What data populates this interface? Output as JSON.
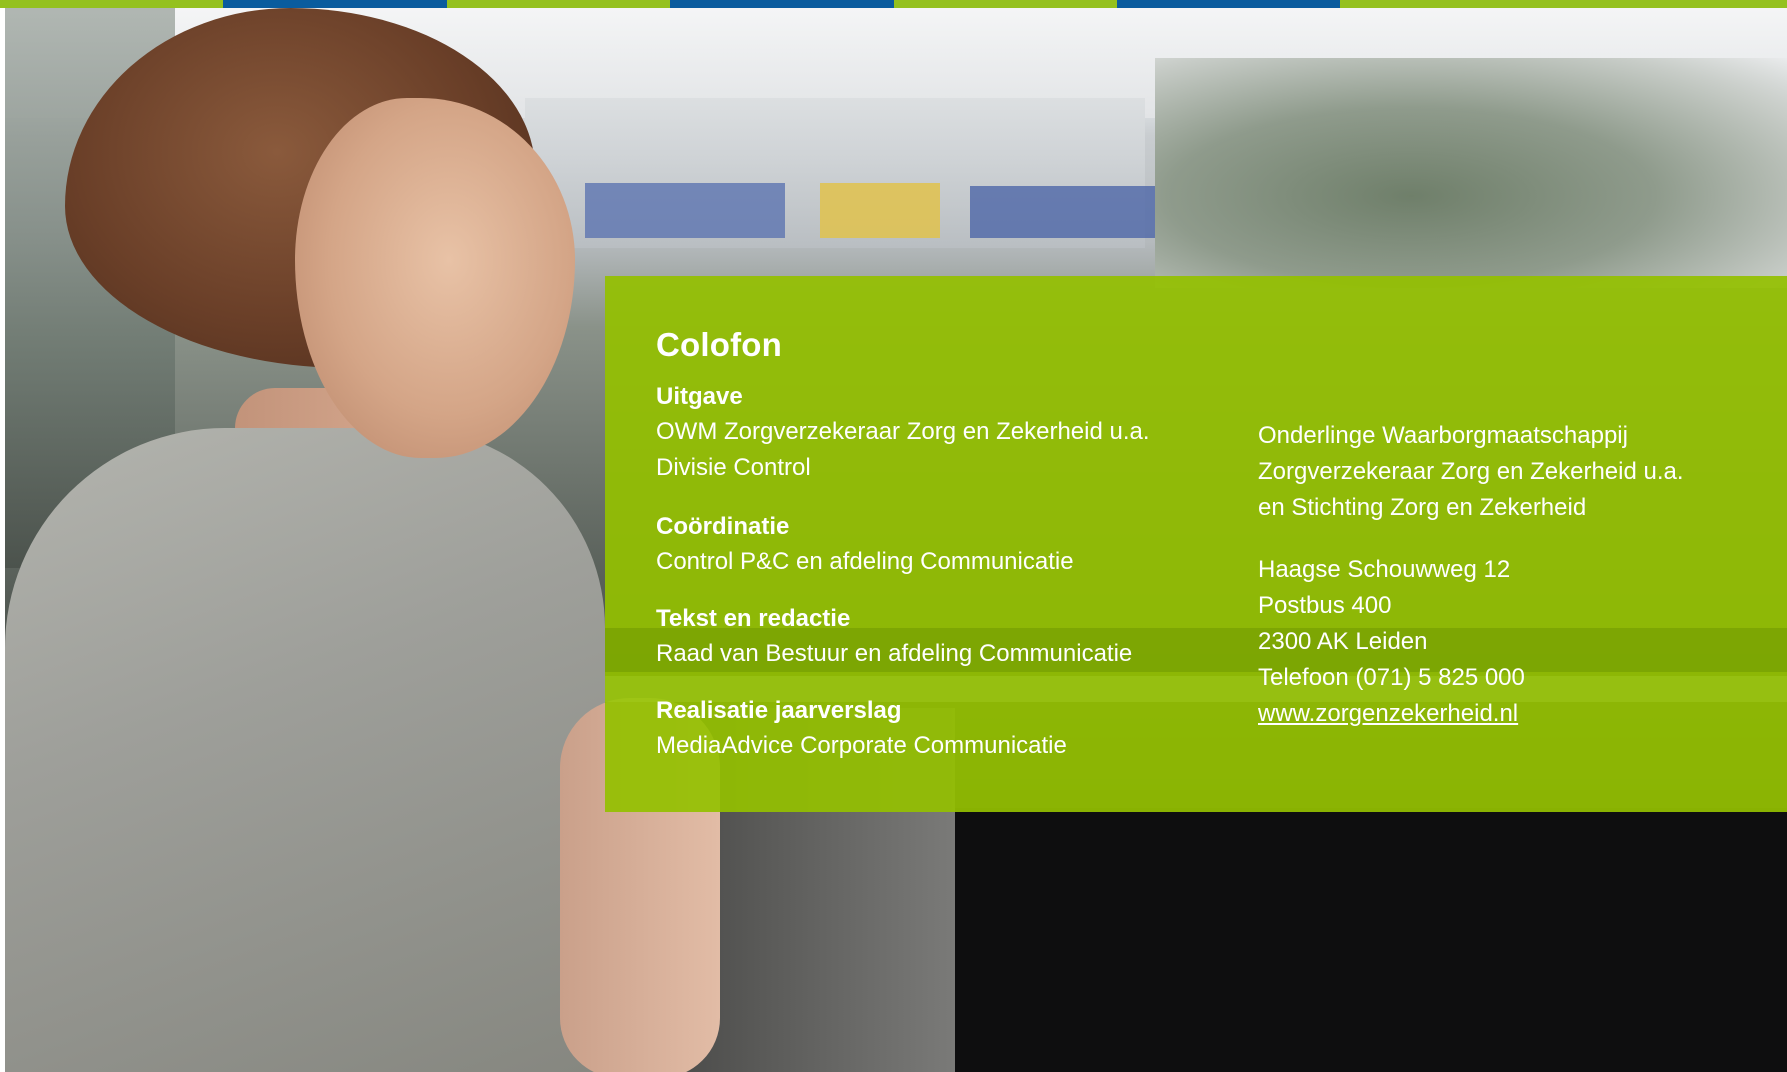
{
  "stripe_colors": [
    "#94c11f",
    "#0a5c9e",
    "#94c11f",
    "#0a5c9e",
    "#94c11f",
    "#0a5c9e",
    "#94c11f",
    "#94c11f"
  ],
  "colofon": {
    "title": "Colofon",
    "sections": [
      {
        "heading": "Uitgave",
        "lines": [
          "OWM Zorgverzekeraar Zorg en Zekerheid u.a.",
          "Divisie Control"
        ]
      },
      {
        "heading": "Coördinatie",
        "lines": [
          "Control P&C en afdeling Communicatie"
        ]
      },
      {
        "heading": "Tekst en redactie",
        "lines": [
          "Raad van Bestuur en afdeling Communicatie"
        ]
      },
      {
        "heading": "Realisatie jaarverslag",
        "lines": [
          "MediaAdvice Corporate Communicatie"
        ]
      }
    ],
    "organisation": [
      "Onderlinge Waarborgmaatschappij",
      "Zorgverzekeraar Zorg en Zekerheid u.a.",
      "en Stichting Zorg en Zekerheid"
    ],
    "address": [
      "Haagse Schouwweg 12",
      "Postbus 400",
      "2300 AK Leiden",
      "Telefoon (071) 5 825 000"
    ],
    "website": "www.zorgenzekerheid.nl"
  },
  "colors": {
    "panel_green": "#94c000",
    "brand_blue": "#0a5c9e",
    "text": "#ffffff"
  }
}
